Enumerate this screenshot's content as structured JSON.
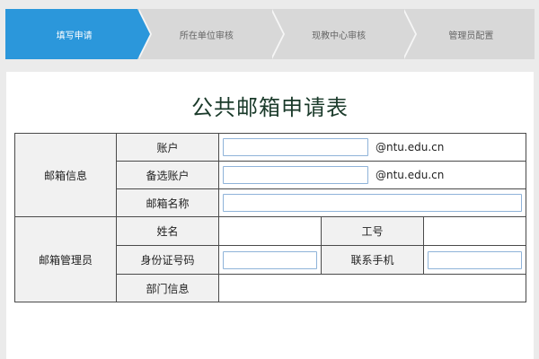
{
  "steps": [
    {
      "label": "填写申请",
      "active": true
    },
    {
      "label": "所在单位审核",
      "active": false
    },
    {
      "label": "现教中心审核",
      "active": false
    },
    {
      "label": "管理员配置",
      "active": false
    }
  ],
  "form": {
    "title": "公共邮箱申请表",
    "mailbox_info": {
      "group_label": "邮箱信息",
      "account_label": "账户",
      "account_value": "",
      "account_suffix": "@ntu.edu.cn",
      "alt_account_label": "备选账户",
      "alt_account_value": "",
      "alt_account_suffix": "@ntu.edu.cn",
      "mailbox_name_label": "邮箱名称",
      "mailbox_name_value": ""
    },
    "manager": {
      "group_label": "邮箱管理员",
      "name_label": "姓名",
      "name_value": "",
      "staff_id_label": "工号",
      "staff_id_value": "",
      "id_number_label": "身份证号码",
      "id_number_value": "",
      "phone_label": "联系手机",
      "phone_value": "",
      "department_label": "部门信息",
      "department_value": ""
    }
  }
}
